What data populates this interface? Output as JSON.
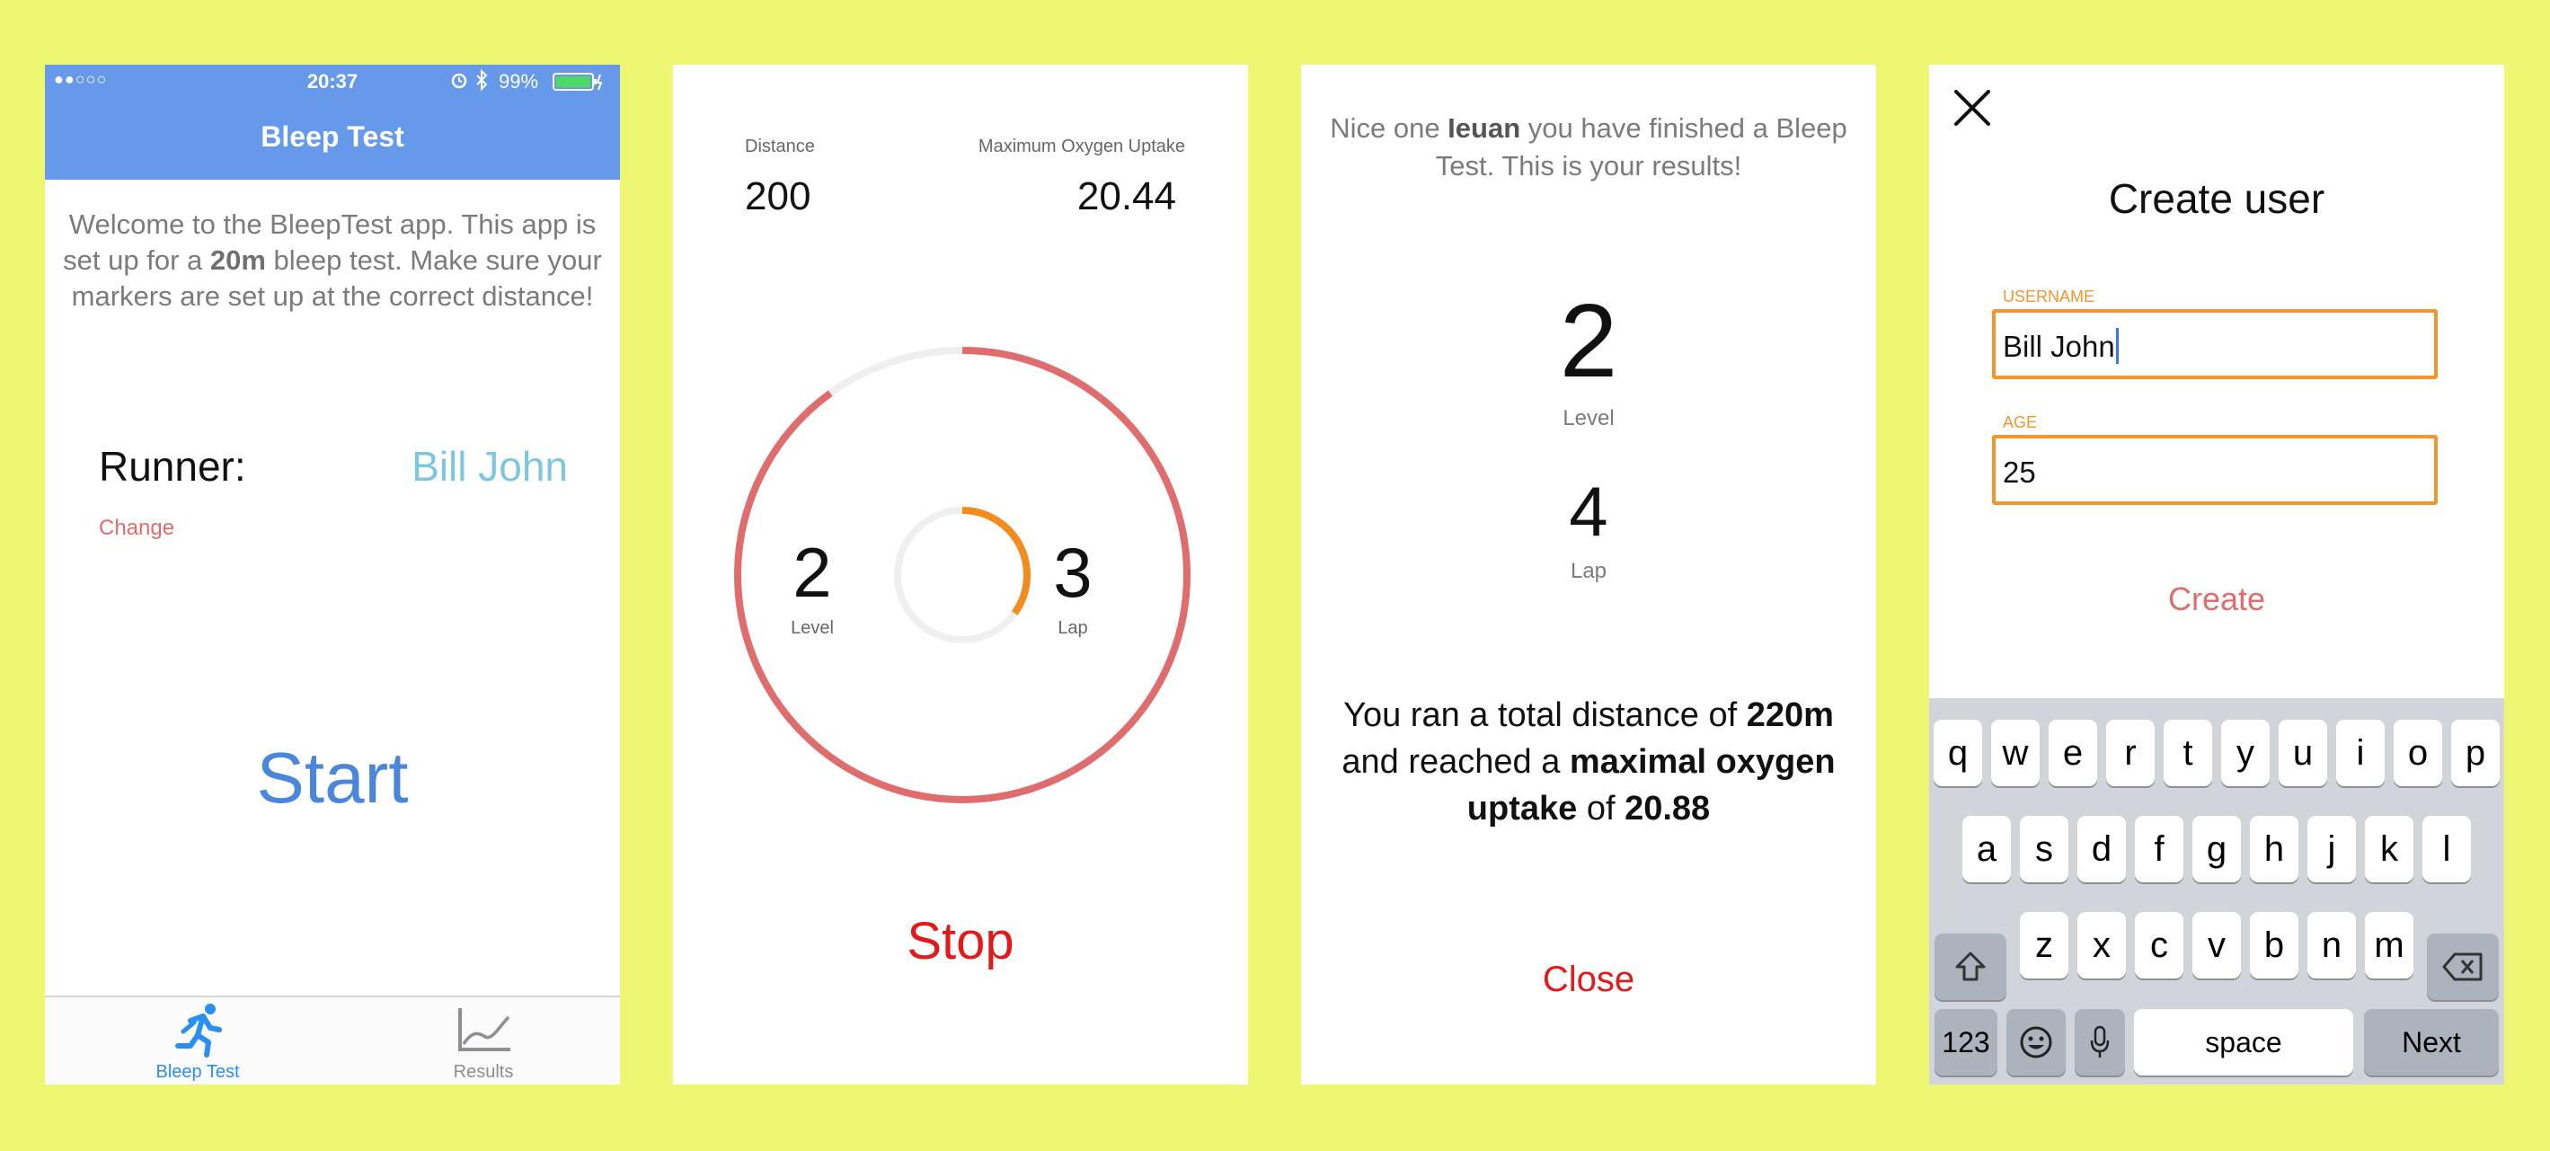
{
  "colors": {
    "background": "#eef772",
    "nav_blue": "#6699ea",
    "start_blue": "#4a86d9",
    "runner_name": "#7ec6df",
    "change_red": "#e06d6d",
    "stop_red": "#e01b1b",
    "ring_red": "#e06d6d",
    "ring_orange": "#f28c1e",
    "field_orange": "#f0962d",
    "create_red": "#e06d6d"
  },
  "screen1": {
    "status": {
      "signal": "●●○○○",
      "time": "20:37",
      "battery": "99%"
    },
    "nav_title": "Bleep Test",
    "welcome_pre": "Welcome to the BleepTest app. This app is set up for a ",
    "welcome_bold": "20m",
    "welcome_post": " bleep test. Make sure your markers are set up at the correct distance!",
    "runner_label": "Runner:",
    "runner_name": "Bill John",
    "change_label": "Change",
    "start_label": "Start",
    "tabs": [
      {
        "label": "Bleep Test",
        "icon": "runner-icon",
        "active": true
      },
      {
        "label": "Results",
        "icon": "chart-icon",
        "active": false
      }
    ]
  },
  "screen2": {
    "distance_label": "Distance",
    "distance_value": "200",
    "oxygen_label": "Maximum Oxygen Uptake",
    "oxygen_value": "20.44",
    "level_value": "2",
    "level_label": "Level",
    "lap_value": "3",
    "lap_label": "Lap",
    "outer_progress": 0.9,
    "inner_progress": 0.35,
    "stop_label": "Stop"
  },
  "screen3": {
    "intro_pre": "Nice one ",
    "intro_name": "Ieuan",
    "intro_post": " you have finished a Bleep Test. This is your results!",
    "level_value": "2",
    "level_label": "Level",
    "lap_value": "4",
    "lap_label": "Lap",
    "summary_1": "You ran a total distance of ",
    "summary_distance": "220m",
    "summary_2": " and reached a ",
    "summary_bold": "maximal oxygen uptake",
    "summary_3": " of ",
    "summary_value": "20.88",
    "close_label": "Close"
  },
  "screen4": {
    "title": "Create user",
    "username_label": "USERNAME",
    "username_value": "Bill John",
    "age_label": "AGE",
    "age_value": "25",
    "create_label": "Create",
    "keyboard": {
      "row1": [
        "q",
        "w",
        "e",
        "r",
        "t",
        "y",
        "u",
        "i",
        "o",
        "p"
      ],
      "row2": [
        "a",
        "s",
        "d",
        "f",
        "g",
        "h",
        "j",
        "k",
        "l"
      ],
      "row3": [
        "z",
        "x",
        "c",
        "v",
        "b",
        "n",
        "m"
      ],
      "numbers_key": "123",
      "space_key": "space",
      "next_key": "Next"
    }
  }
}
